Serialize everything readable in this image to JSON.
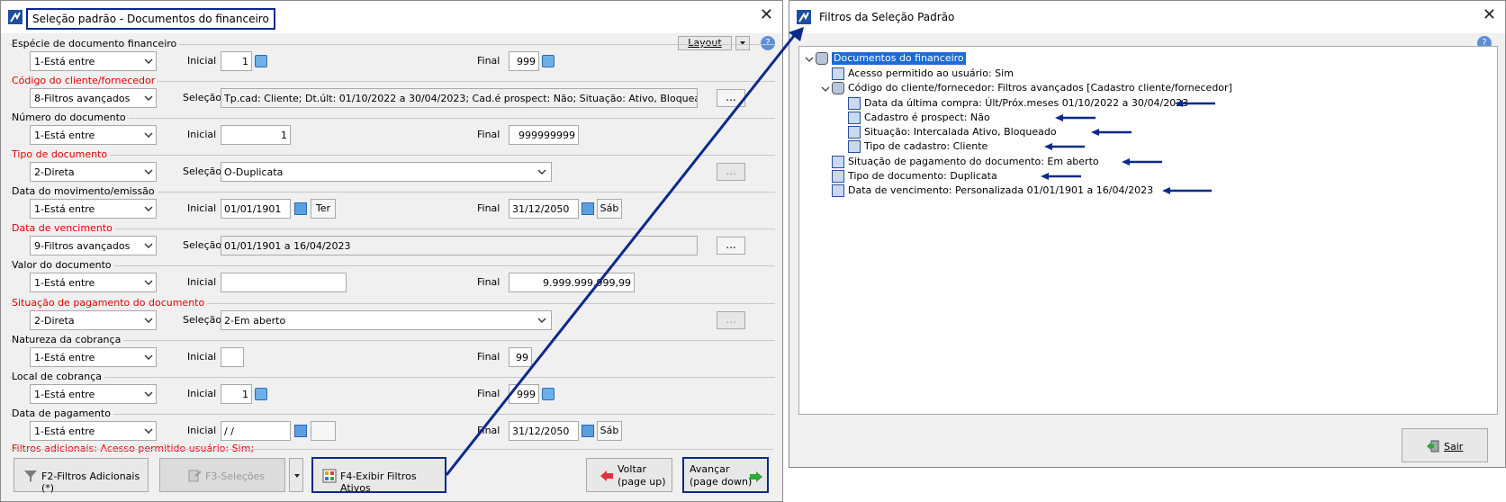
{
  "win1": {
    "title": "Seleção padrão - Documentos do financeiro",
    "layout_label": "Layout",
    "help_label": "?",
    "close_label": "✕",
    "fields": [
      {
        "label": "Espécie de documento financeiro",
        "red": false,
        "op": "1-Está entre",
        "kind": "range",
        "initial_label": "Inicial",
        "initial": "1",
        "final_label": "Final",
        "final": "999"
      },
      {
        "label": "Código do cliente/fornecedor",
        "red": true,
        "op": "8-Filtros avançados",
        "kind": "selection",
        "sel_label": "Seleção",
        "value": "Tp.cad: Cliente; Dt.últ: 01/10/2022 a 30/04/2023; Cad.é prospect: Não; Situação: Ativo, Bloqueado;",
        "button": "..."
      },
      {
        "label": "Número do documento",
        "red": false,
        "op": "1-Está entre",
        "kind": "range",
        "initial_label": "Inicial",
        "initial": "1",
        "final_label": "Final",
        "final": "999999999"
      },
      {
        "label": "Tipo de documento",
        "red": true,
        "op": "2-Direta",
        "kind": "selection",
        "sel_label": "Seleção",
        "value": "O-Duplicata",
        "button": "..."
      },
      {
        "label": "Data do movimento/emissão",
        "red": false,
        "op": "1-Está entre",
        "kind": "date",
        "initial_label": "Inicial",
        "initial": "01/01/1901",
        "initial_day": "Ter",
        "final_label": "Final",
        "final": "31/12/2050",
        "final_day": "Sáb"
      },
      {
        "label": "Data de vencimento",
        "red": true,
        "op": "9-Filtros avançados",
        "kind": "selection",
        "sel_label": "Seleção",
        "value": "01/01/1901 a 16/04/2023",
        "button": "..."
      },
      {
        "label": "Valor do documento",
        "red": false,
        "op": "1-Está entre",
        "kind": "range",
        "initial_label": "Inicial",
        "initial": "",
        "final_label": "Final",
        "final": "9.999.999.999,99"
      },
      {
        "label": "Situação de pagamento do documento",
        "red": true,
        "op": "2-Direta",
        "kind": "selection",
        "sel_label": "Seleção",
        "value": "2-Em aberto",
        "button": "..."
      },
      {
        "label": "Natureza da cobrança",
        "red": false,
        "op": "1-Está entre",
        "kind": "range",
        "initial_label": "Inicial",
        "initial": "",
        "final_label": "Final",
        "final": "99"
      },
      {
        "label": "Local de cobrança",
        "red": false,
        "op": "1-Está entre",
        "kind": "range",
        "initial_label": "Inicial",
        "initial": "1",
        "final_label": "Final",
        "final": "999"
      },
      {
        "label": "Data de pagamento",
        "red": false,
        "op": "1-Está entre",
        "kind": "date",
        "initial_label": "Inicial",
        "initial": " / /",
        "initial_day": "",
        "final_label": "Final",
        "final": "31/12/2050",
        "final_day": "Sáb"
      }
    ],
    "extra_filters": "Filtros adicionais: Acesso permitido usuário: Sim;",
    "buttons": {
      "f2": "F2-Filtros Adicionais (*)",
      "f3": "F3-Seleções",
      "f4": "F4-Exibir Filtros Ativos",
      "voltar1": "Voltar",
      "voltar2": "(page up)",
      "avancar1": "Avançar",
      "avancar2": "(page down)"
    }
  },
  "win2": {
    "title": "Filtros da Seleção Padrão",
    "close_label": "✕",
    "help_label": "?",
    "tree": [
      "Documentos do financeiro",
      "Acesso permitido ao usuário: Sim",
      "Código do cliente/fornecedor: Filtros avançados [Cadastro cliente/fornecedor]",
      "Data da última compra: Últ/Próx.meses 01/10/2022 a 30/04/2023",
      "Cadastro é prospect: Não",
      "Situação: Intercalada Ativo, Bloqueado",
      "Tipo de cadastro: Cliente",
      "Situação de pagamento do documento: Em aberto",
      "Tipo de documento: Duplicata",
      "Data de vencimento: Personalizada 01/01/1901 a 16/04/2023"
    ],
    "exit_label": "Sair"
  },
  "colors": {
    "accent": "#0b2a8a",
    "required_label": "#e00000",
    "tree_selection": "#1c6bd8"
  }
}
